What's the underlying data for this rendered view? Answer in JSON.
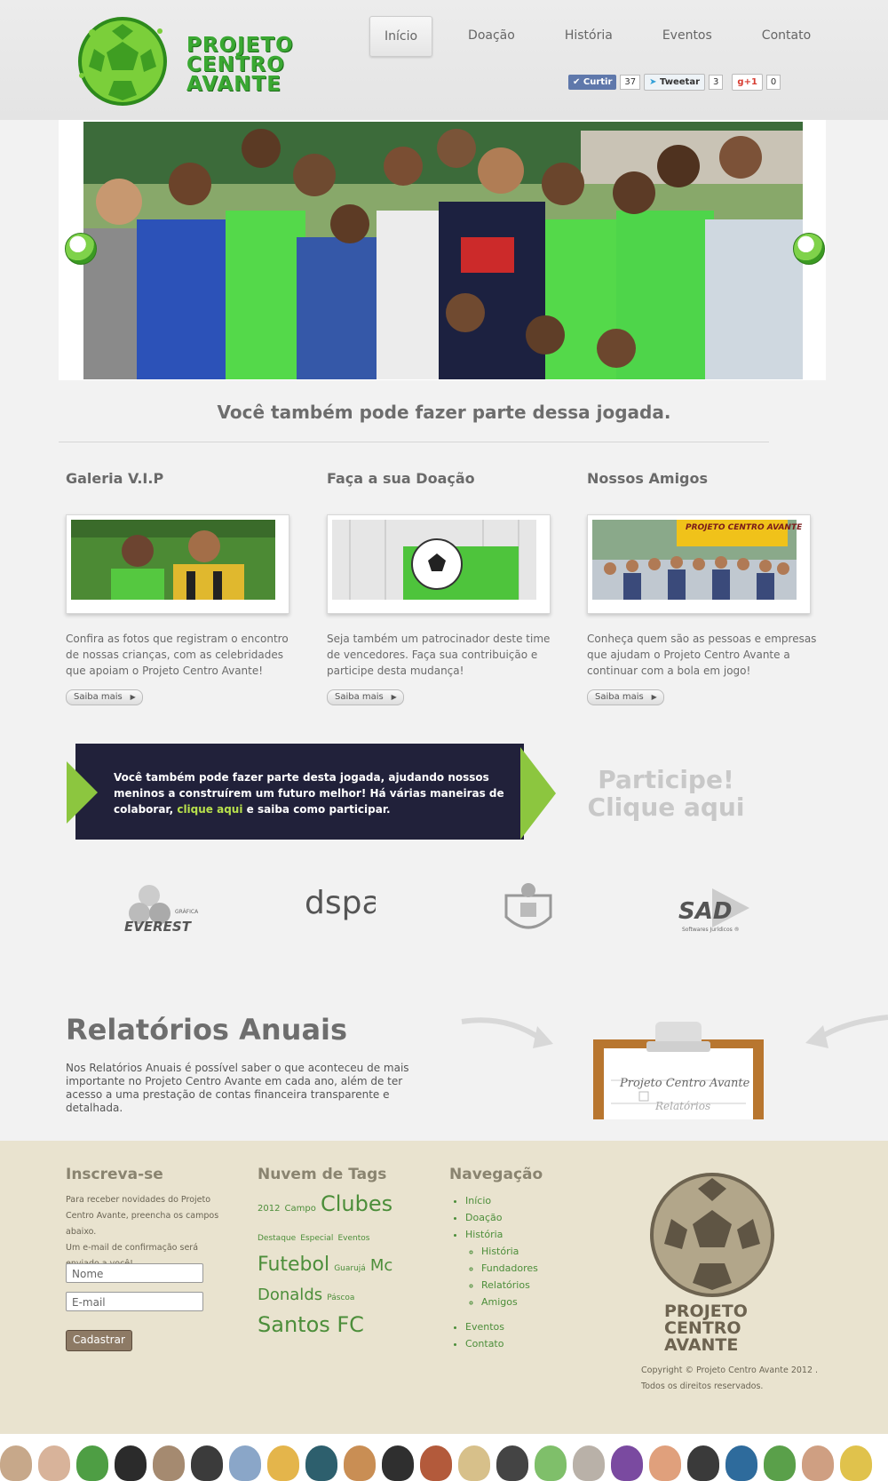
{
  "site": {
    "logo_lines": [
      "PROJETO",
      "CENTRO",
      "AVANTE"
    ]
  },
  "nav": [
    {
      "label": "Início",
      "active": true
    },
    {
      "label": "Doação",
      "active": false
    },
    {
      "label": "História",
      "active": false
    },
    {
      "label": "Eventos",
      "active": false
    },
    {
      "label": "Contato",
      "active": false
    }
  ],
  "social": {
    "like_label": "Curtir",
    "like_count": "37",
    "tweet_label": "Tweetar",
    "tweet_count": "3",
    "gplus_label": "+1",
    "gplus_count": "0"
  },
  "headline": "Você também pode fazer parte dessa jogada.",
  "columns": [
    {
      "title": "Galeria V.I.P",
      "text": "Confira as fotos que registram o encontro de nossas crianças, com as celebridades que apoiam o Projeto Centro Avante!",
      "button": "Saiba mais"
    },
    {
      "title": "Faça a sua Doação",
      "text": "Seja também um patrocinador deste time de vencedores. Faça sua contribuição e participe desta mudança!",
      "button": "Saiba mais"
    },
    {
      "title": "Nossos Amigos",
      "text": "Conheça quem são as pessoas e empresas que ajudam o Projeto Centro Avante a continuar com a bola em jogo!",
      "button": "Saiba mais",
      "photo_banner": "PROJETO CENTRO AVANTE"
    }
  ],
  "banner": {
    "text_before": "Você também pode fazer parte desta jogada, ajudando nossos meninos a construírem um futuro melhor! Há várias maneiras de colaborar,",
    "link": "clique aqui",
    "text_after": "e saiba como participar.",
    "cta_line1": "Participe!",
    "cta_line2": "Clique aqui"
  },
  "sponsors": [
    {
      "name": "EVEREST",
      "sub": "GRÁFICA"
    },
    {
      "name": "dspa"
    },
    {
      "name": "crest"
    },
    {
      "name": "SAD",
      "sub": "Softwares Jurídicos ®"
    }
  ],
  "reports": {
    "title": "Relatórios Anuais",
    "text": "Nos Relatórios Anuais é possível saber o que aconteceu de mais importante no Projeto Centro Avante em cada ano, além de ter acesso a uma prestação de contas financeira transparente e detalhada.",
    "clipboard_line1": "Projeto Centro Avante",
    "clipboard_line2": "Relatórios"
  },
  "footer": {
    "subscribe_title": "Inscreva-se",
    "subscribe_text1": "Para receber novidades do Projeto Centro Avante, preencha os campos abaixo.",
    "subscribe_text2": "Um e-mail de confirmação será enviado a você!",
    "name_placeholder": "Nome",
    "email_placeholder": "E-mail",
    "submit": "Cadastrar",
    "tags_title": "Nuvem de Tags",
    "tags": [
      "2012",
      "Campo",
      "Clubes",
      "Destaque",
      "Especial",
      "Eventos",
      "Futebol",
      "Guarujá",
      "Mc Donalds",
      "Páscoa",
      "Santos FC"
    ],
    "nav_title": "Navegação",
    "nav_items": [
      "Início",
      "Doação",
      "História"
    ],
    "nav_sub": [
      "História",
      "Fundadores",
      "Relatórios",
      "Amigos"
    ],
    "nav_items2": [
      "Eventos",
      "Contato"
    ],
    "copyright1": "Copyright © Projeto Centro Avante 2012 .",
    "copyright2": "Todos os direitos reservados."
  }
}
